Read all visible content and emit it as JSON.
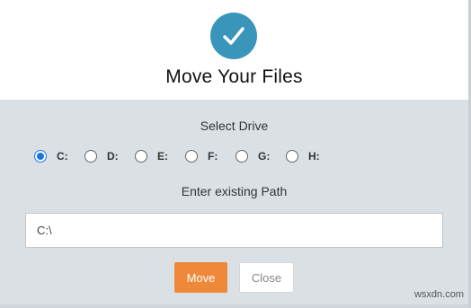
{
  "dialog": {
    "title": "Move Your Files",
    "icon": "check-circle-icon",
    "accent_color": "#3a95bb"
  },
  "drive_section": {
    "label": "Select Drive",
    "options": [
      {
        "label": "C:",
        "selected": true
      },
      {
        "label": "D:",
        "selected": false
      },
      {
        "label": "E:",
        "selected": false
      },
      {
        "label": "F:",
        "selected": false
      },
      {
        "label": "G:",
        "selected": false
      },
      {
        "label": "H:",
        "selected": false
      }
    ]
  },
  "path_section": {
    "label": "Enter existing Path",
    "value": "C:\\"
  },
  "buttons": {
    "move_label": "Move",
    "close_label": "Close",
    "move_color": "#f0883a"
  },
  "watermark": "wsxdn.com"
}
